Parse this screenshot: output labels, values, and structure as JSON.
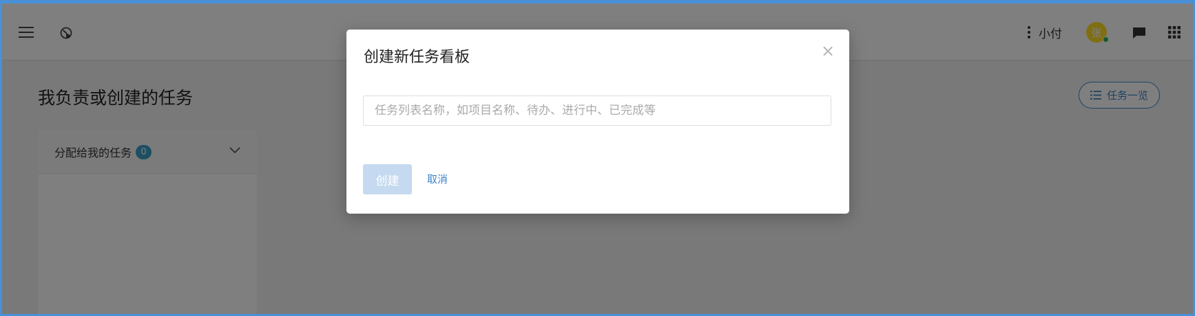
{
  "header": {
    "user_name": "小付",
    "avatar_initial": "张",
    "icons": {
      "menu": "hamburger-menu-icon",
      "dashboard": "dashboard-gauge-icon",
      "more": "more-vertical-icon",
      "chat": "chat-bubble-icon",
      "apps": "apps-grid-icon"
    }
  },
  "page": {
    "title": "我负责或创建的任务",
    "overview_button": "任务一览"
  },
  "panel": {
    "label": "分配给我的任务",
    "count": "0"
  },
  "modal": {
    "title": "创建新任务看板",
    "close": "×",
    "input_placeholder": "任务列表名称，如项目名称、待办、进行中、已完成等",
    "input_value": "",
    "create_button": "创建",
    "cancel_button": "取消"
  },
  "colors": {
    "accent": "#3f83c6",
    "badge": "#3a9ec4",
    "avatar": "#ffde24",
    "presence": "#2bb45b",
    "create_disabled": "#c5daf0"
  }
}
